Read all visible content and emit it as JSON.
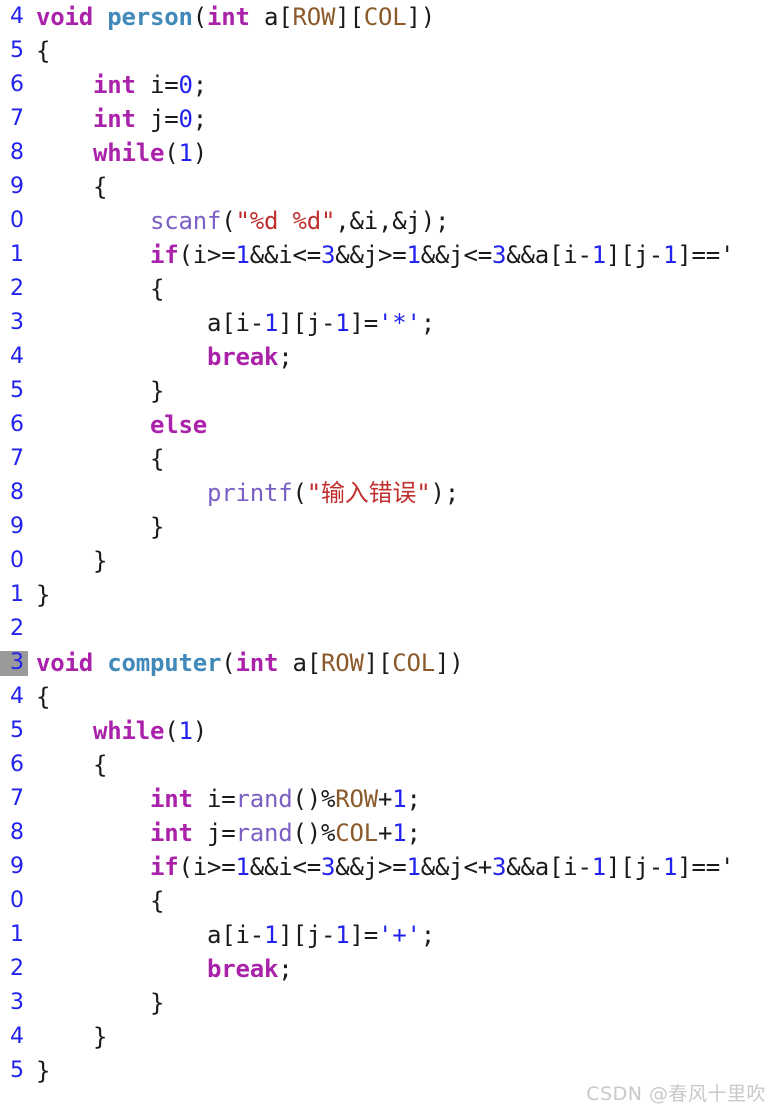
{
  "editor": {
    "language": "c",
    "background_color": "#ffffff",
    "gutter_color": "#b9b9b9",
    "active_badge_color": "#9a9a9a",
    "active_line_number": "3",
    "theme_colors": {
      "keyword": "#aa22aa",
      "function_name": "#4189b9",
      "library_function": "#7b5fc4",
      "string": "#c03030",
      "number": "#2222ee",
      "char_literal": "#2222ee",
      "macro": "#8b5a2b",
      "plain": "#1a1a1a"
    }
  },
  "watermark": {
    "text": "CSDN @春风十里吹"
  },
  "lines": [
    {
      "num": "4",
      "active": false,
      "tokens": [
        {
          "t": "void",
          "c": "kw"
        },
        {
          "t": " ",
          "c": "plain"
        },
        {
          "t": "person",
          "c": "fn"
        },
        {
          "t": "(",
          "c": "punct"
        },
        {
          "t": "int",
          "c": "kw"
        },
        {
          "t": " a[",
          "c": "plain"
        },
        {
          "t": "ROW",
          "c": "macro"
        },
        {
          "t": "][",
          "c": "plain"
        },
        {
          "t": "COL",
          "c": "macro"
        },
        {
          "t": "])",
          "c": "plain"
        }
      ]
    },
    {
      "num": "5",
      "active": false,
      "tokens": [
        {
          "t": "{",
          "c": "plain"
        }
      ]
    },
    {
      "num": "6",
      "active": false,
      "tokens": [
        {
          "t": "    ",
          "c": "plain"
        },
        {
          "t": "int",
          "c": "kw"
        },
        {
          "t": " i=",
          "c": "plain"
        },
        {
          "t": "0",
          "c": "num"
        },
        {
          "t": ";",
          "c": "plain"
        }
      ]
    },
    {
      "num": "7",
      "active": false,
      "tokens": [
        {
          "t": "    ",
          "c": "plain"
        },
        {
          "t": "int",
          "c": "kw"
        },
        {
          "t": " j=",
          "c": "plain"
        },
        {
          "t": "0",
          "c": "num"
        },
        {
          "t": ";",
          "c": "plain"
        }
      ]
    },
    {
      "num": "8",
      "active": false,
      "tokens": [
        {
          "t": "    ",
          "c": "plain"
        },
        {
          "t": "while",
          "c": "kw"
        },
        {
          "t": "(",
          "c": "plain"
        },
        {
          "t": "1",
          "c": "num"
        },
        {
          "t": ")",
          "c": "plain"
        }
      ]
    },
    {
      "num": "9",
      "active": false,
      "tokens": [
        {
          "t": "    {",
          "c": "plain"
        }
      ]
    },
    {
      "num": "0",
      "active": false,
      "tokens": [
        {
          "t": "        ",
          "c": "plain"
        },
        {
          "t": "scanf",
          "c": "lib"
        },
        {
          "t": "(",
          "c": "plain"
        },
        {
          "t": "\"%d %d\"",
          "c": "str"
        },
        {
          "t": ",&i,&j);",
          "c": "plain"
        }
      ]
    },
    {
      "num": "1",
      "active": false,
      "tokens": [
        {
          "t": "        ",
          "c": "plain"
        },
        {
          "t": "if",
          "c": "kw"
        },
        {
          "t": "(i>=",
          "c": "plain"
        },
        {
          "t": "1",
          "c": "num"
        },
        {
          "t": "&&i<=",
          "c": "plain"
        },
        {
          "t": "3",
          "c": "num"
        },
        {
          "t": "&&j>=",
          "c": "plain"
        },
        {
          "t": "1",
          "c": "num"
        },
        {
          "t": "&&j<=",
          "c": "plain"
        },
        {
          "t": "3",
          "c": "num"
        },
        {
          "t": "&&a[i-",
          "c": "plain"
        },
        {
          "t": "1",
          "c": "num"
        },
        {
          "t": "][j-",
          "c": "plain"
        },
        {
          "t": "1",
          "c": "num"
        },
        {
          "t": "]=='",
          "c": "plain"
        }
      ]
    },
    {
      "num": "2",
      "active": false,
      "tokens": [
        {
          "t": "        {",
          "c": "plain"
        }
      ]
    },
    {
      "num": "3",
      "active": false,
      "tokens": [
        {
          "t": "            a[i-",
          "c": "plain"
        },
        {
          "t": "1",
          "c": "num"
        },
        {
          "t": "][j-",
          "c": "plain"
        },
        {
          "t": "1",
          "c": "num"
        },
        {
          "t": "]=",
          "c": "plain"
        },
        {
          "t": "'*'",
          "c": "chr"
        },
        {
          "t": ";",
          "c": "plain"
        }
      ]
    },
    {
      "num": "4",
      "active": false,
      "tokens": [
        {
          "t": "            ",
          "c": "plain"
        },
        {
          "t": "break",
          "c": "kw"
        },
        {
          "t": ";",
          "c": "plain"
        }
      ]
    },
    {
      "num": "5",
      "active": false,
      "tokens": [
        {
          "t": "        }",
          "c": "plain"
        }
      ]
    },
    {
      "num": "6",
      "active": false,
      "tokens": [
        {
          "t": "        ",
          "c": "plain"
        },
        {
          "t": "else",
          "c": "kw"
        }
      ]
    },
    {
      "num": "7",
      "active": false,
      "tokens": [
        {
          "t": "        {",
          "c": "plain"
        }
      ]
    },
    {
      "num": "8",
      "active": false,
      "tokens": [
        {
          "t": "            ",
          "c": "plain"
        },
        {
          "t": "printf",
          "c": "lib"
        },
        {
          "t": "(",
          "c": "plain"
        },
        {
          "t": "\"输入错误\"",
          "c": "str"
        },
        {
          "t": ");",
          "c": "plain"
        }
      ]
    },
    {
      "num": "9",
      "active": false,
      "tokens": [
        {
          "t": "        }",
          "c": "plain"
        }
      ]
    },
    {
      "num": "0",
      "active": false,
      "tokens": [
        {
          "t": "    }",
          "c": "plain"
        }
      ]
    },
    {
      "num": "1",
      "active": false,
      "tokens": [
        {
          "t": "}",
          "c": "plain"
        }
      ]
    },
    {
      "num": "2",
      "active": false,
      "tokens": [
        {
          "t": "",
          "c": "plain"
        }
      ]
    },
    {
      "num": "3",
      "active": true,
      "tokens": [
        {
          "t": "void",
          "c": "kw"
        },
        {
          "t": " ",
          "c": "plain"
        },
        {
          "t": "computer",
          "c": "fn"
        },
        {
          "t": "(",
          "c": "punct"
        },
        {
          "t": "int",
          "c": "kw"
        },
        {
          "t": " a[",
          "c": "plain"
        },
        {
          "t": "ROW",
          "c": "macro"
        },
        {
          "t": "][",
          "c": "plain"
        },
        {
          "t": "COL",
          "c": "macro"
        },
        {
          "t": "])",
          "c": "plain"
        }
      ]
    },
    {
      "num": "4",
      "active": false,
      "tokens": [
        {
          "t": "{",
          "c": "plain"
        }
      ]
    },
    {
      "num": "5",
      "active": false,
      "tokens": [
        {
          "t": "    ",
          "c": "plain"
        },
        {
          "t": "while",
          "c": "kw"
        },
        {
          "t": "(",
          "c": "plain"
        },
        {
          "t": "1",
          "c": "num"
        },
        {
          "t": ")",
          "c": "plain"
        }
      ]
    },
    {
      "num": "6",
      "active": false,
      "tokens": [
        {
          "t": "    {",
          "c": "plain"
        }
      ]
    },
    {
      "num": "7",
      "active": false,
      "tokens": [
        {
          "t": "        ",
          "c": "plain"
        },
        {
          "t": "int",
          "c": "kw"
        },
        {
          "t": " i=",
          "c": "plain"
        },
        {
          "t": "rand",
          "c": "lib"
        },
        {
          "t": "()%",
          "c": "plain"
        },
        {
          "t": "ROW",
          "c": "macro"
        },
        {
          "t": "+",
          "c": "plain"
        },
        {
          "t": "1",
          "c": "num"
        },
        {
          "t": ";",
          "c": "plain"
        }
      ]
    },
    {
      "num": "8",
      "active": false,
      "tokens": [
        {
          "t": "        ",
          "c": "plain"
        },
        {
          "t": "int",
          "c": "kw"
        },
        {
          "t": " j=",
          "c": "plain"
        },
        {
          "t": "rand",
          "c": "lib"
        },
        {
          "t": "()%",
          "c": "plain"
        },
        {
          "t": "COL",
          "c": "macro"
        },
        {
          "t": "+",
          "c": "plain"
        },
        {
          "t": "1",
          "c": "num"
        },
        {
          "t": ";",
          "c": "plain"
        }
      ]
    },
    {
      "num": "9",
      "active": false,
      "tokens": [
        {
          "t": "        ",
          "c": "plain"
        },
        {
          "t": "if",
          "c": "kw"
        },
        {
          "t": "(i>=",
          "c": "plain"
        },
        {
          "t": "1",
          "c": "num"
        },
        {
          "t": "&&i<=",
          "c": "plain"
        },
        {
          "t": "3",
          "c": "num"
        },
        {
          "t": "&&j>=",
          "c": "plain"
        },
        {
          "t": "1",
          "c": "num"
        },
        {
          "t": "&&j<+",
          "c": "plain"
        },
        {
          "t": "3",
          "c": "num"
        },
        {
          "t": "&&a[i-",
          "c": "plain"
        },
        {
          "t": "1",
          "c": "num"
        },
        {
          "t": "][j-",
          "c": "plain"
        },
        {
          "t": "1",
          "c": "num"
        },
        {
          "t": "]=='",
          "c": "plain"
        }
      ]
    },
    {
      "num": "0",
      "active": false,
      "tokens": [
        {
          "t": "        {",
          "c": "plain"
        }
      ]
    },
    {
      "num": "1",
      "active": false,
      "tokens": [
        {
          "t": "            a[i-",
          "c": "plain"
        },
        {
          "t": "1",
          "c": "num"
        },
        {
          "t": "][j-",
          "c": "plain"
        },
        {
          "t": "1",
          "c": "num"
        },
        {
          "t": "]=",
          "c": "plain"
        },
        {
          "t": "'+'",
          "c": "chr"
        },
        {
          "t": ";",
          "c": "plain"
        }
      ]
    },
    {
      "num": "2",
      "active": false,
      "tokens": [
        {
          "t": "            ",
          "c": "plain"
        },
        {
          "t": "break",
          "c": "kw"
        },
        {
          "t": ";",
          "c": "plain"
        }
      ]
    },
    {
      "num": "3",
      "active": false,
      "tokens": [
        {
          "t": "        }",
          "c": "plain"
        }
      ]
    },
    {
      "num": "4",
      "active": false,
      "tokens": [
        {
          "t": "    }",
          "c": "plain"
        }
      ]
    },
    {
      "num": "5",
      "active": false,
      "tokens": [
        {
          "t": "}",
          "c": "plain"
        }
      ]
    }
  ]
}
